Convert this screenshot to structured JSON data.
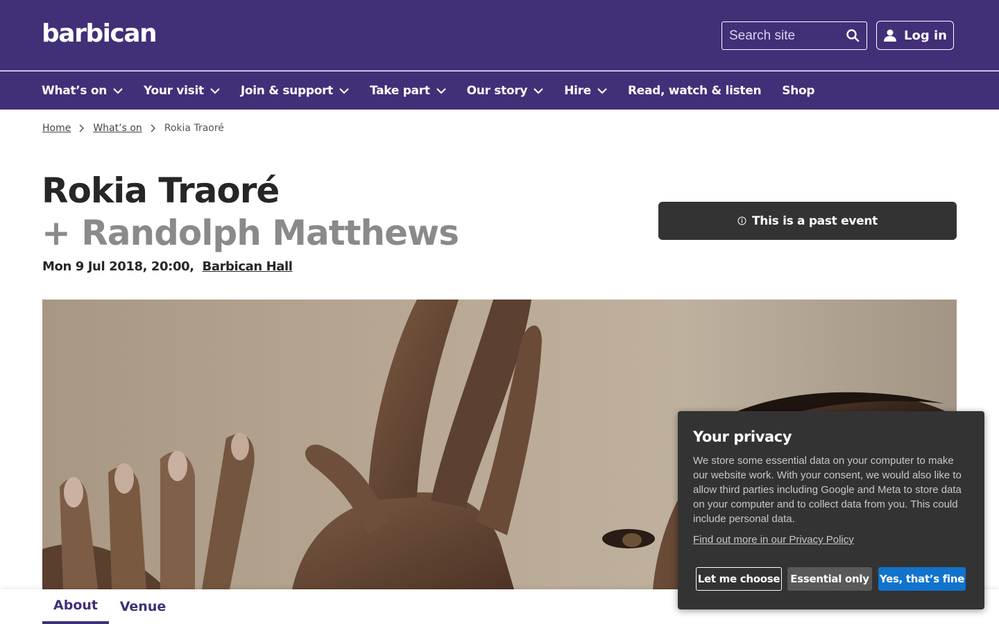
{
  "header": {
    "logo": "barbican",
    "search_placeholder": "Search site",
    "login_label": "Log in"
  },
  "nav": {
    "items": [
      {
        "label": "What’s on",
        "has_dropdown": true
      },
      {
        "label": "Your visit",
        "has_dropdown": true
      },
      {
        "label": "Join & support",
        "has_dropdown": true
      },
      {
        "label": "Take part",
        "has_dropdown": true
      },
      {
        "label": "Our story",
        "has_dropdown": true
      },
      {
        "label": "Hire",
        "has_dropdown": true
      },
      {
        "label": "Read, watch & listen",
        "has_dropdown": false
      },
      {
        "label": "Shop",
        "has_dropdown": false
      }
    ]
  },
  "breadcrumb": {
    "home": "Home",
    "section": "What’s on",
    "current": "Rokia Traoré"
  },
  "event": {
    "title": "Rokia Traoré",
    "subtitle": "+ Randolph Matthews",
    "datetime": "Mon 9 Jul 2018, 20:00,",
    "venue": "Barbican Hall",
    "status": "This is a past event"
  },
  "tabs": [
    {
      "label": "About",
      "active": true
    },
    {
      "label": "Venue",
      "active": false
    }
  ],
  "cookie": {
    "title": "Your privacy",
    "text": "We store some essential data on your computer to make our website work. With your consent, we would also like to allow third parties including Google and Meta to store data on your computer and to collect data from you. This could include personal data.",
    "link": "Find out more in our Privacy Policy",
    "buttons": {
      "choose": "Let me choose",
      "essential": "Essential only",
      "accept": "Yes, that’s fine"
    }
  },
  "colors": {
    "brand": "#412f78",
    "dark": "#333333",
    "accept_blue": "#1173cc"
  },
  "icons": [
    "search-icon",
    "user-icon",
    "chevron-down-icon",
    "chevron-right-icon",
    "info-icon"
  ]
}
